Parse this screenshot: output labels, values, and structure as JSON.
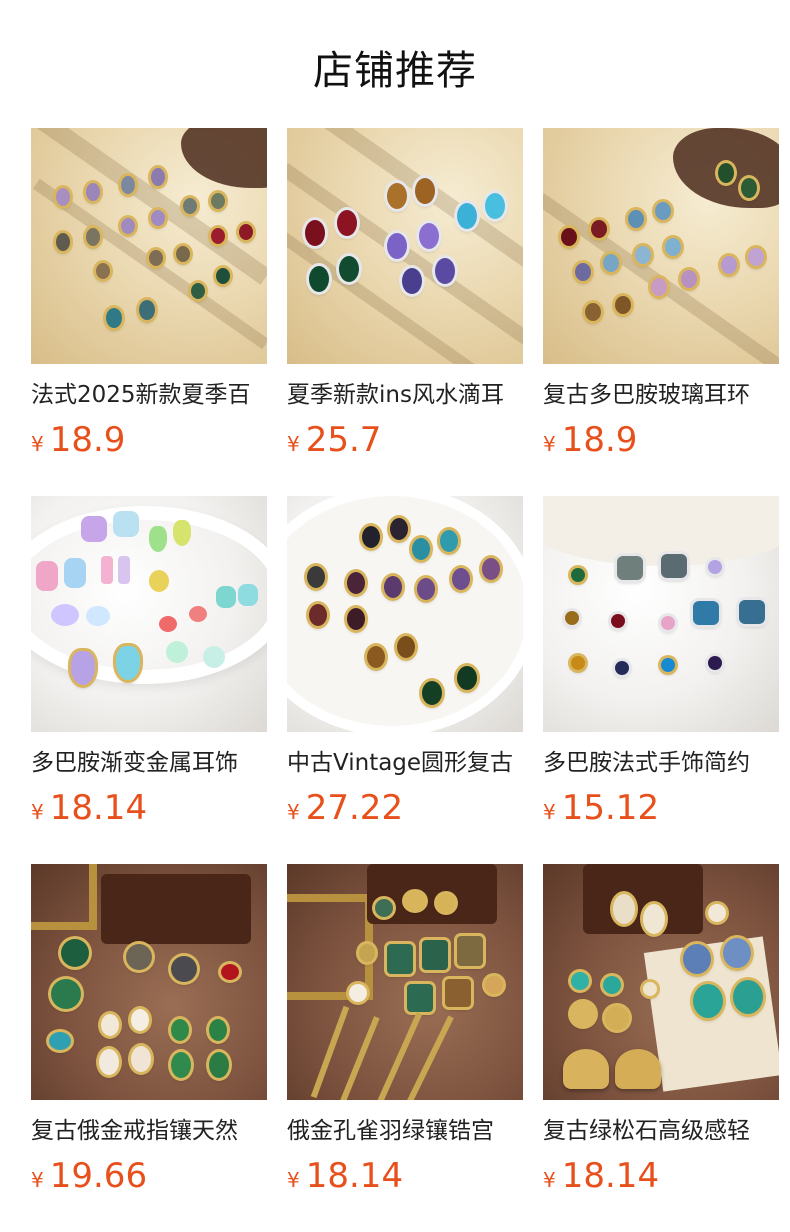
{
  "page": {
    "title": "店铺推荐"
  },
  "products": [
    {
      "name": "法式2025新款夏季百",
      "currency": "¥",
      "price": "18.9"
    },
    {
      "name": "夏季新款ins风水滴耳",
      "currency": "¥",
      "price": "25.7"
    },
    {
      "name": "复古多巴胺玻璃耳环",
      "currency": "¥",
      "price": "18.9"
    },
    {
      "name": "多巴胺渐变金属耳饰",
      "currency": "¥",
      "price": "18.14"
    },
    {
      "name": "中古Vintage圆形复古",
      "currency": "¥",
      "price": "27.22"
    },
    {
      "name": "多巴胺法式手饰简约",
      "currency": "¥",
      "price": "15.12"
    },
    {
      "name": "复古俄金戒指镶天然",
      "currency": "¥",
      "price": "19.66"
    },
    {
      "name": "俄金孔雀羽绿镶锆宫",
      "currency": "¥",
      "price": "18.14"
    },
    {
      "name": "复古绿松石高级感轻",
      "currency": "¥",
      "price": "18.14"
    }
  ]
}
